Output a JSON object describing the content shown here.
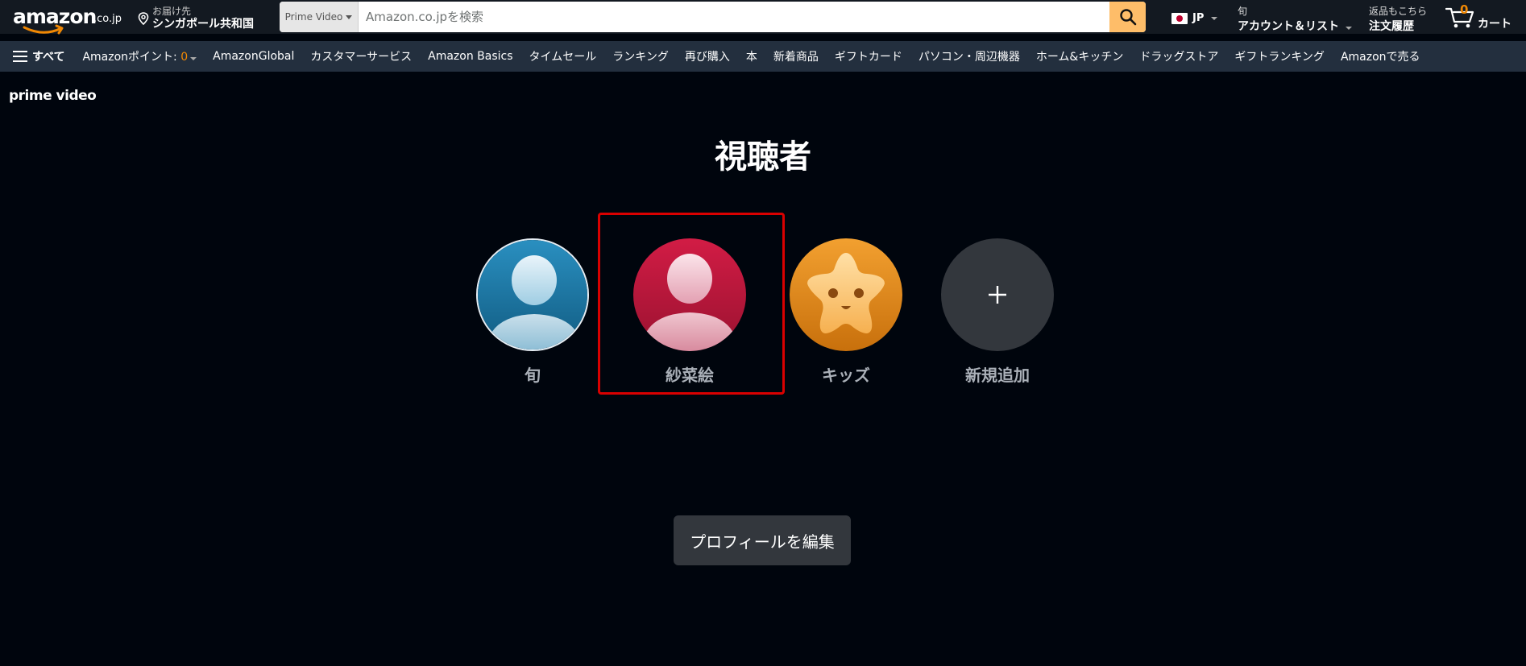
{
  "header": {
    "logo_text": "amazon",
    "logo_tld": ".co.jp",
    "deliver_to_label": "お届け先",
    "deliver_to_location": "シンガポール共和国",
    "search": {
      "category": "Prime Video",
      "placeholder": "Amazon.co.jpを検索",
      "value": ""
    },
    "language": "JP",
    "account": {
      "greeting": "旬",
      "label": "アカウント＆リスト"
    },
    "orders": {
      "line1": "返品もこちら",
      "line2": "注文履歴"
    },
    "cart": {
      "count": "0",
      "label": "カート"
    }
  },
  "subnav": {
    "all_label": "すべて",
    "points_label": "Amazonポイント: ",
    "points_value": "0",
    "items": [
      "AmazonGlobal",
      "カスタマーサービス",
      "Amazon Basics",
      "タイムセール",
      "ランキング",
      "再び購入",
      "本",
      "新着商品",
      "ギフトカード",
      "パソコン・周辺機器",
      "ホーム&キッチン",
      "ドラッグストア",
      "ギフトランキング",
      "Amazonで売る"
    ]
  },
  "prime_video": {
    "logo": "prime video",
    "title": "視聴者",
    "profiles": [
      {
        "name": "旬",
        "icon": "person-avatar-blue-icon",
        "color": "#1f7aa6"
      },
      {
        "name": "紗菜絵",
        "icon": "person-avatar-red-icon",
        "color": "#b81a3b"
      },
      {
        "name": "キッズ",
        "icon": "kids-star-avatar-icon",
        "color": "#e88a17"
      },
      {
        "name": "新規追加",
        "icon": "plus-icon",
        "color": "#33373d"
      }
    ],
    "selected_profile": "紗菜絵",
    "edit_button": "プロフィールを編集"
  }
}
